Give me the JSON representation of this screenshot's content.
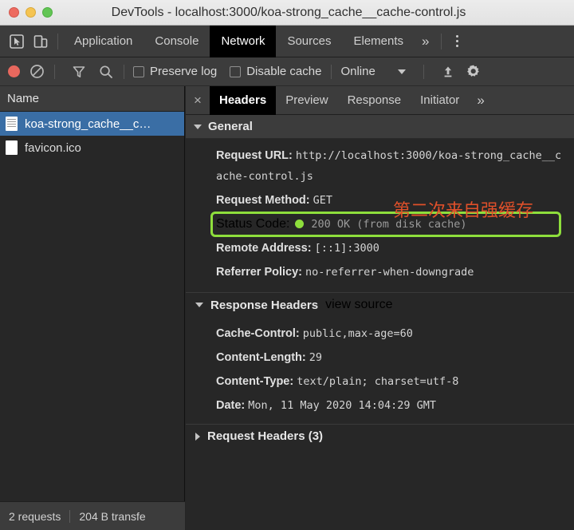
{
  "window": {
    "title": "DevTools - localhost:3000/koa-strong_cache__cache-control.js",
    "traffic_lights": [
      "close",
      "minimize",
      "zoom"
    ]
  },
  "devtools_tabs": {
    "icons": [
      "inspect-element-icon",
      "device-toolbar-icon"
    ],
    "items": [
      {
        "label": "Application",
        "active": false
      },
      {
        "label": "Console",
        "active": false
      },
      {
        "label": "Network",
        "active": true
      },
      {
        "label": "Sources",
        "active": false
      },
      {
        "label": "Elements",
        "active": false
      }
    ],
    "overflow": "»",
    "menu": "kebab-menu"
  },
  "network_toolbar": {
    "record_label": "record-button",
    "clear_label": "clear-button",
    "filter_label": "filter-button",
    "search_label": "search-button",
    "preserve_log": {
      "label": "Preserve log",
      "checked": false
    },
    "disable_cache": {
      "label": "Disable cache",
      "checked": false
    },
    "throttle": {
      "value": "Online"
    },
    "import_label": "import-har-button",
    "settings_label": "settings-button"
  },
  "requests_panel": {
    "column_header": "Name",
    "rows": [
      {
        "name": "koa-strong_cache__c…",
        "selected": true,
        "icon": "js-file-icon"
      },
      {
        "name": "favicon.ico",
        "selected": false,
        "icon": "image-file-icon"
      }
    ]
  },
  "status_bar": {
    "requests": "2 requests",
    "transferred": "204 B transfe"
  },
  "details_panel": {
    "close": "×",
    "tabs": [
      {
        "label": "Headers",
        "active": true
      },
      {
        "label": "Preview",
        "active": false
      },
      {
        "label": "Response",
        "active": false
      },
      {
        "label": "Initiator",
        "active": false
      }
    ],
    "overflow": "»",
    "general": {
      "section_title": "General",
      "rows": [
        {
          "key": "Request URL:",
          "value": "http://localhost:3000/koa-strong_cache__cache-control.js"
        },
        {
          "key": "Request Method:",
          "value": "GET"
        }
      ],
      "status": {
        "key": "Status Code:",
        "value": "200 OK (from disk cache)",
        "dot_color": "#8ede3c",
        "highlight_color": "#8ede3c"
      },
      "rows_after": [
        {
          "key": "Remote Address:",
          "value": "[::1]:3000"
        },
        {
          "key": "Referrer Policy:",
          "value": "no-referrer-when-downgrade"
        }
      ]
    },
    "response_headers": {
      "section_title": "Response Headers",
      "view_source": "view source",
      "rows": [
        {
          "key": "Cache-Control:",
          "value": "public,max-age=60"
        },
        {
          "key": "Content-Length:",
          "value": "29"
        },
        {
          "key": "Content-Type:",
          "value": "text/plain; charset=utf-8"
        },
        {
          "key": "Date:",
          "value": "Mon, 11 May 2020 14:04:29 GMT"
        }
      ]
    },
    "request_headers": {
      "section_title": "Request Headers (3)",
      "expanded": false
    }
  },
  "annotation": {
    "text": "第二次来自强缓存",
    "color": "#e0502a"
  }
}
